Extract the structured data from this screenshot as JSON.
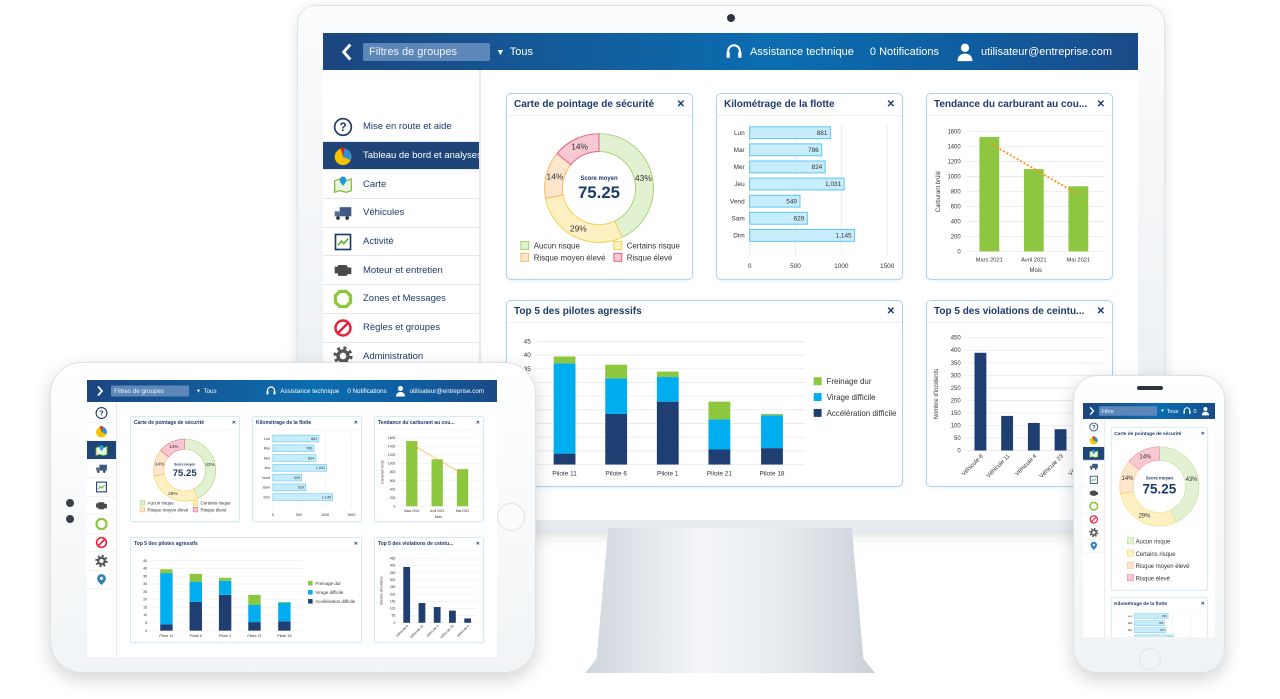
{
  "header": {
    "filter_placeholder": "Filtres de groupes",
    "group_value": "Tous",
    "support": "Assistance technique",
    "notifications": "0 Notifications",
    "user": "utilisateur@entreprise.com"
  },
  "phone_header": {
    "filter_placeholder": "Filtre",
    "group_value": "Tous",
    "notifications": "0"
  },
  "sidebar": {
    "items": [
      {
        "label": "Mise en route et aide",
        "icon": "help-icon"
      },
      {
        "label": "Tableau de bord et analyses",
        "icon": "dashboard-icon"
      },
      {
        "label": "Carte",
        "icon": "map-icon"
      },
      {
        "label": "Véhicules",
        "icon": "truck-icon"
      },
      {
        "label": "Activité",
        "icon": "activity-icon"
      },
      {
        "label": "Moteur et entretien",
        "icon": "engine-icon"
      },
      {
        "label": "Zones et Messages",
        "icon": "zones-icon"
      },
      {
        "label": "Règles et groupes",
        "icon": "rules-icon"
      },
      {
        "label": "Administration",
        "icon": "gear-icon"
      },
      {
        "icon": "location-pin-icon"
      }
    ]
  },
  "colors": {
    "header": "#1d4a86",
    "active_item": "#1f4478",
    "card_border": "#a9d5ef"
  },
  "chart_data": [
    {
      "type": "pie",
      "title": "Carte de pointage de sécurité",
      "categories": [
        "Aucun risque",
        "Certains risque",
        "Risque moyen élevé",
        "Risque élevé"
      ],
      "values": [
        43,
        29,
        14,
        14
      ],
      "labels": [
        "43%",
        "29%",
        "14%",
        "14%"
      ],
      "center_label": "Score moyen",
      "center_value": "75.25",
      "colors": [
        {
          "fill": "#e3f1d3",
          "stroke": "#a5d36f"
        },
        {
          "fill": "#fdf1c4",
          "stroke": "#f3cf4c"
        },
        {
          "fill": "#fde6cc",
          "stroke": "#f4b868"
        },
        {
          "fill": "#f8c8d3",
          "stroke": "#e9607f"
        }
      ]
    },
    {
      "type": "bar",
      "orientation": "horizontal",
      "title": "Kilométrage de la flotte",
      "categories": [
        "Lun",
        "Mar",
        "Mer",
        "Jeu",
        "Vend",
        "Sam",
        "Dim"
      ],
      "values": [
        881,
        786,
        824,
        1031,
        549,
        629,
        1145
      ],
      "value_labels": [
        "881",
        "786",
        "824",
        "1,031",
        "549",
        "629",
        "1,145"
      ],
      "xlim": [
        0,
        1500
      ],
      "xticks": [
        0,
        500,
        1000,
        1500
      ],
      "color": "#c7ecfb",
      "stroke": "#5cc6ef"
    },
    {
      "type": "bar",
      "title": "Tendance du carburant au cou...",
      "categories": [
        "Mars 2021",
        "Avril 2021",
        "Mai 2021"
      ],
      "values": [
        1530,
        1100,
        870
      ],
      "trend": [
        1450,
        1105,
        760
      ],
      "ylim": [
        0,
        1600
      ],
      "yticks": [
        0,
        200,
        400,
        600,
        800,
        1000,
        1200,
        1400,
        1600
      ],
      "xlabel": "Mois",
      "ylabel": "Carburant brûlé",
      "color": "#8dc63f",
      "trend_color": "#f39a1e"
    },
    {
      "type": "bar",
      "stacked": true,
      "title": "Top 5 des pilotes agressifs",
      "categories": [
        "Pilote 11",
        "Pilote 6",
        "Pilote 1",
        "Pilote 21",
        "Pilote 18"
      ],
      "series": [
        {
          "name": "Accélération difficile",
          "values": [
            4,
            18.5,
            23,
            5.5,
            6
          ],
          "color": "#1f3f73"
        },
        {
          "name": "Virage difficile",
          "values": [
            33,
            13,
            9,
            11,
            12
          ],
          "color": "#00aeef"
        },
        {
          "name": "Freinage dur",
          "values": [
            2.5,
            5,
            2,
            6.5,
            0.5
          ],
          "color": "#8dc63f"
        }
      ],
      "ylim": [
        0,
        45
      ],
      "yticks": [
        0,
        5,
        10,
        15,
        20,
        25,
        30,
        35,
        40,
        45
      ],
      "legend": "right"
    },
    {
      "type": "bar",
      "title": "Top 5 des violations de ceintu...",
      "categories": [
        "Véhicule 8",
        "Véhicule 11",
        "Véhicule 4",
        "Véhicule 23",
        "Véhicule 6"
      ],
      "values": [
        390,
        138,
        110,
        85,
        30
      ],
      "ylim": [
        0,
        450
      ],
      "yticks": [
        0,
        50,
        100,
        150,
        200,
        250,
        300,
        350,
        400,
        450
      ],
      "ylabel": "Nombre d'incidents",
      "color": "#1f3f73"
    }
  ]
}
